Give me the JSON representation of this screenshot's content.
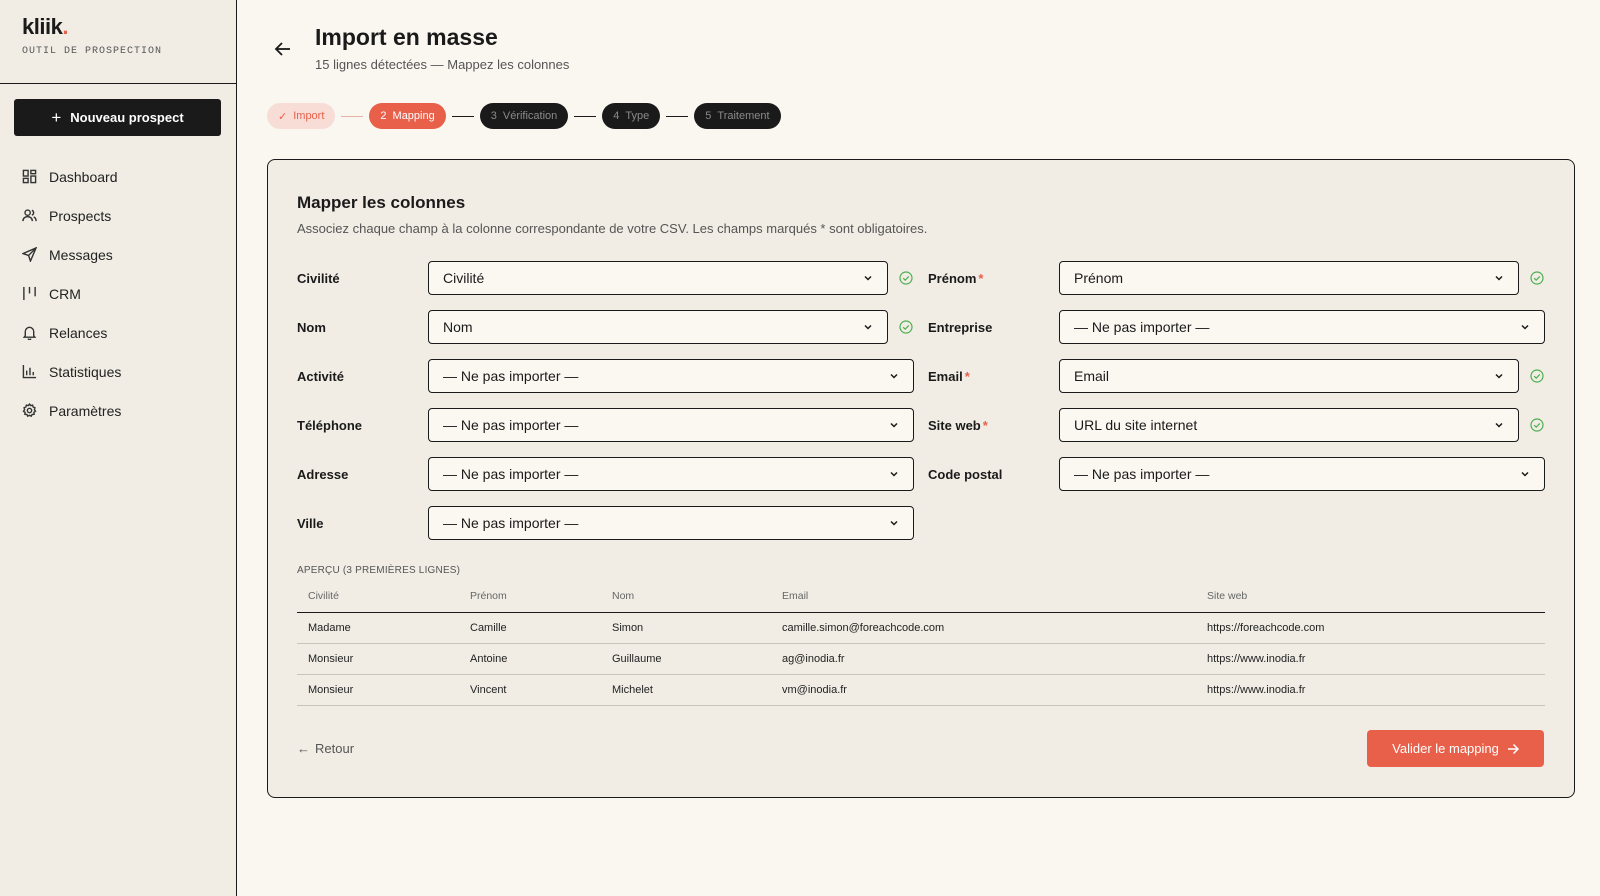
{
  "brand": {
    "logo_text": "kliik",
    "logo_dot": ".",
    "tagline": "OUTIL DE PROSPECTION"
  },
  "sidebar": {
    "new_button": "Nouveau prospect",
    "items": [
      {
        "label": "Dashboard",
        "icon": "grid-icon"
      },
      {
        "label": "Prospects",
        "icon": "users-icon"
      },
      {
        "label": "Messages",
        "icon": "send-icon"
      },
      {
        "label": "CRM",
        "icon": "kanban-icon"
      },
      {
        "label": "Relances",
        "icon": "bell-icon"
      },
      {
        "label": "Statistiques",
        "icon": "bar-chart-icon"
      },
      {
        "label": "Paramètres",
        "icon": "gear-icon"
      }
    ]
  },
  "header": {
    "title": "Import en masse",
    "subtitle": "15 lignes détectées — Mappez les colonnes"
  },
  "stepper": [
    {
      "label": "Import",
      "state": "done"
    },
    {
      "num": "2",
      "label": "Mapping",
      "state": "active"
    },
    {
      "num": "3",
      "label": "Vérification",
      "state": "todo"
    },
    {
      "num": "4",
      "label": "Type",
      "state": "todo"
    },
    {
      "num": "5",
      "label": "Traitement",
      "state": "todo"
    }
  ],
  "card": {
    "title": "Mapper les colonnes",
    "description": "Associez chaque champ à la colonne correspondante de votre CSV. Les champs marqués * sont obligatoires.",
    "required_marker": "*",
    "fields": {
      "civilite": {
        "label": "Civilité",
        "value": "Civilité",
        "mapped": true
      },
      "prenom": {
        "label": "Prénom",
        "value": "Prénom",
        "required": true,
        "mapped": true
      },
      "nom": {
        "label": "Nom",
        "value": "Nom",
        "mapped": true
      },
      "entreprise": {
        "label": "Entreprise",
        "value": "— Ne pas importer —"
      },
      "activite": {
        "label": "Activité",
        "value": "— Ne pas importer —"
      },
      "email": {
        "label": "Email",
        "value": "Email",
        "required": true,
        "mapped": true
      },
      "telephone": {
        "label": "Téléphone",
        "value": "— Ne pas importer —"
      },
      "siteweb": {
        "label": "Site web",
        "value": "URL du site internet",
        "required": true,
        "mapped": true
      },
      "adresse": {
        "label": "Adresse",
        "value": "— Ne pas importer —"
      },
      "codepostal": {
        "label": "Code postal",
        "value": "— Ne pas importer —"
      },
      "ville": {
        "label": "Ville",
        "value": "— Ne pas importer —"
      }
    },
    "preview": {
      "label": "APERÇU (3 PREMIÈRES LIGNES)",
      "headers": [
        "Civilité",
        "Prénom",
        "Nom",
        "Email",
        "Site web"
      ],
      "rows": [
        [
          "Madame",
          "Camille",
          "Simon",
          "camille.simon@foreachcode.com",
          "https://foreachcode.com"
        ],
        [
          "Monsieur",
          "Antoine",
          "Guillaume",
          "ag@inodia.fr",
          "https://www.inodia.fr"
        ],
        [
          "Monsieur",
          "Vincent",
          "Michelet",
          "vm@inodia.fr",
          "https://www.inodia.fr"
        ]
      ]
    },
    "back_label": "Retour",
    "validate_label": "Valider le mapping"
  },
  "colors": {
    "accent": "#e8604a",
    "dark": "#1a1a1a",
    "success": "#4caf50",
    "sidebar_bg": "#f1ede5",
    "page_bg": "#faf7f1"
  }
}
